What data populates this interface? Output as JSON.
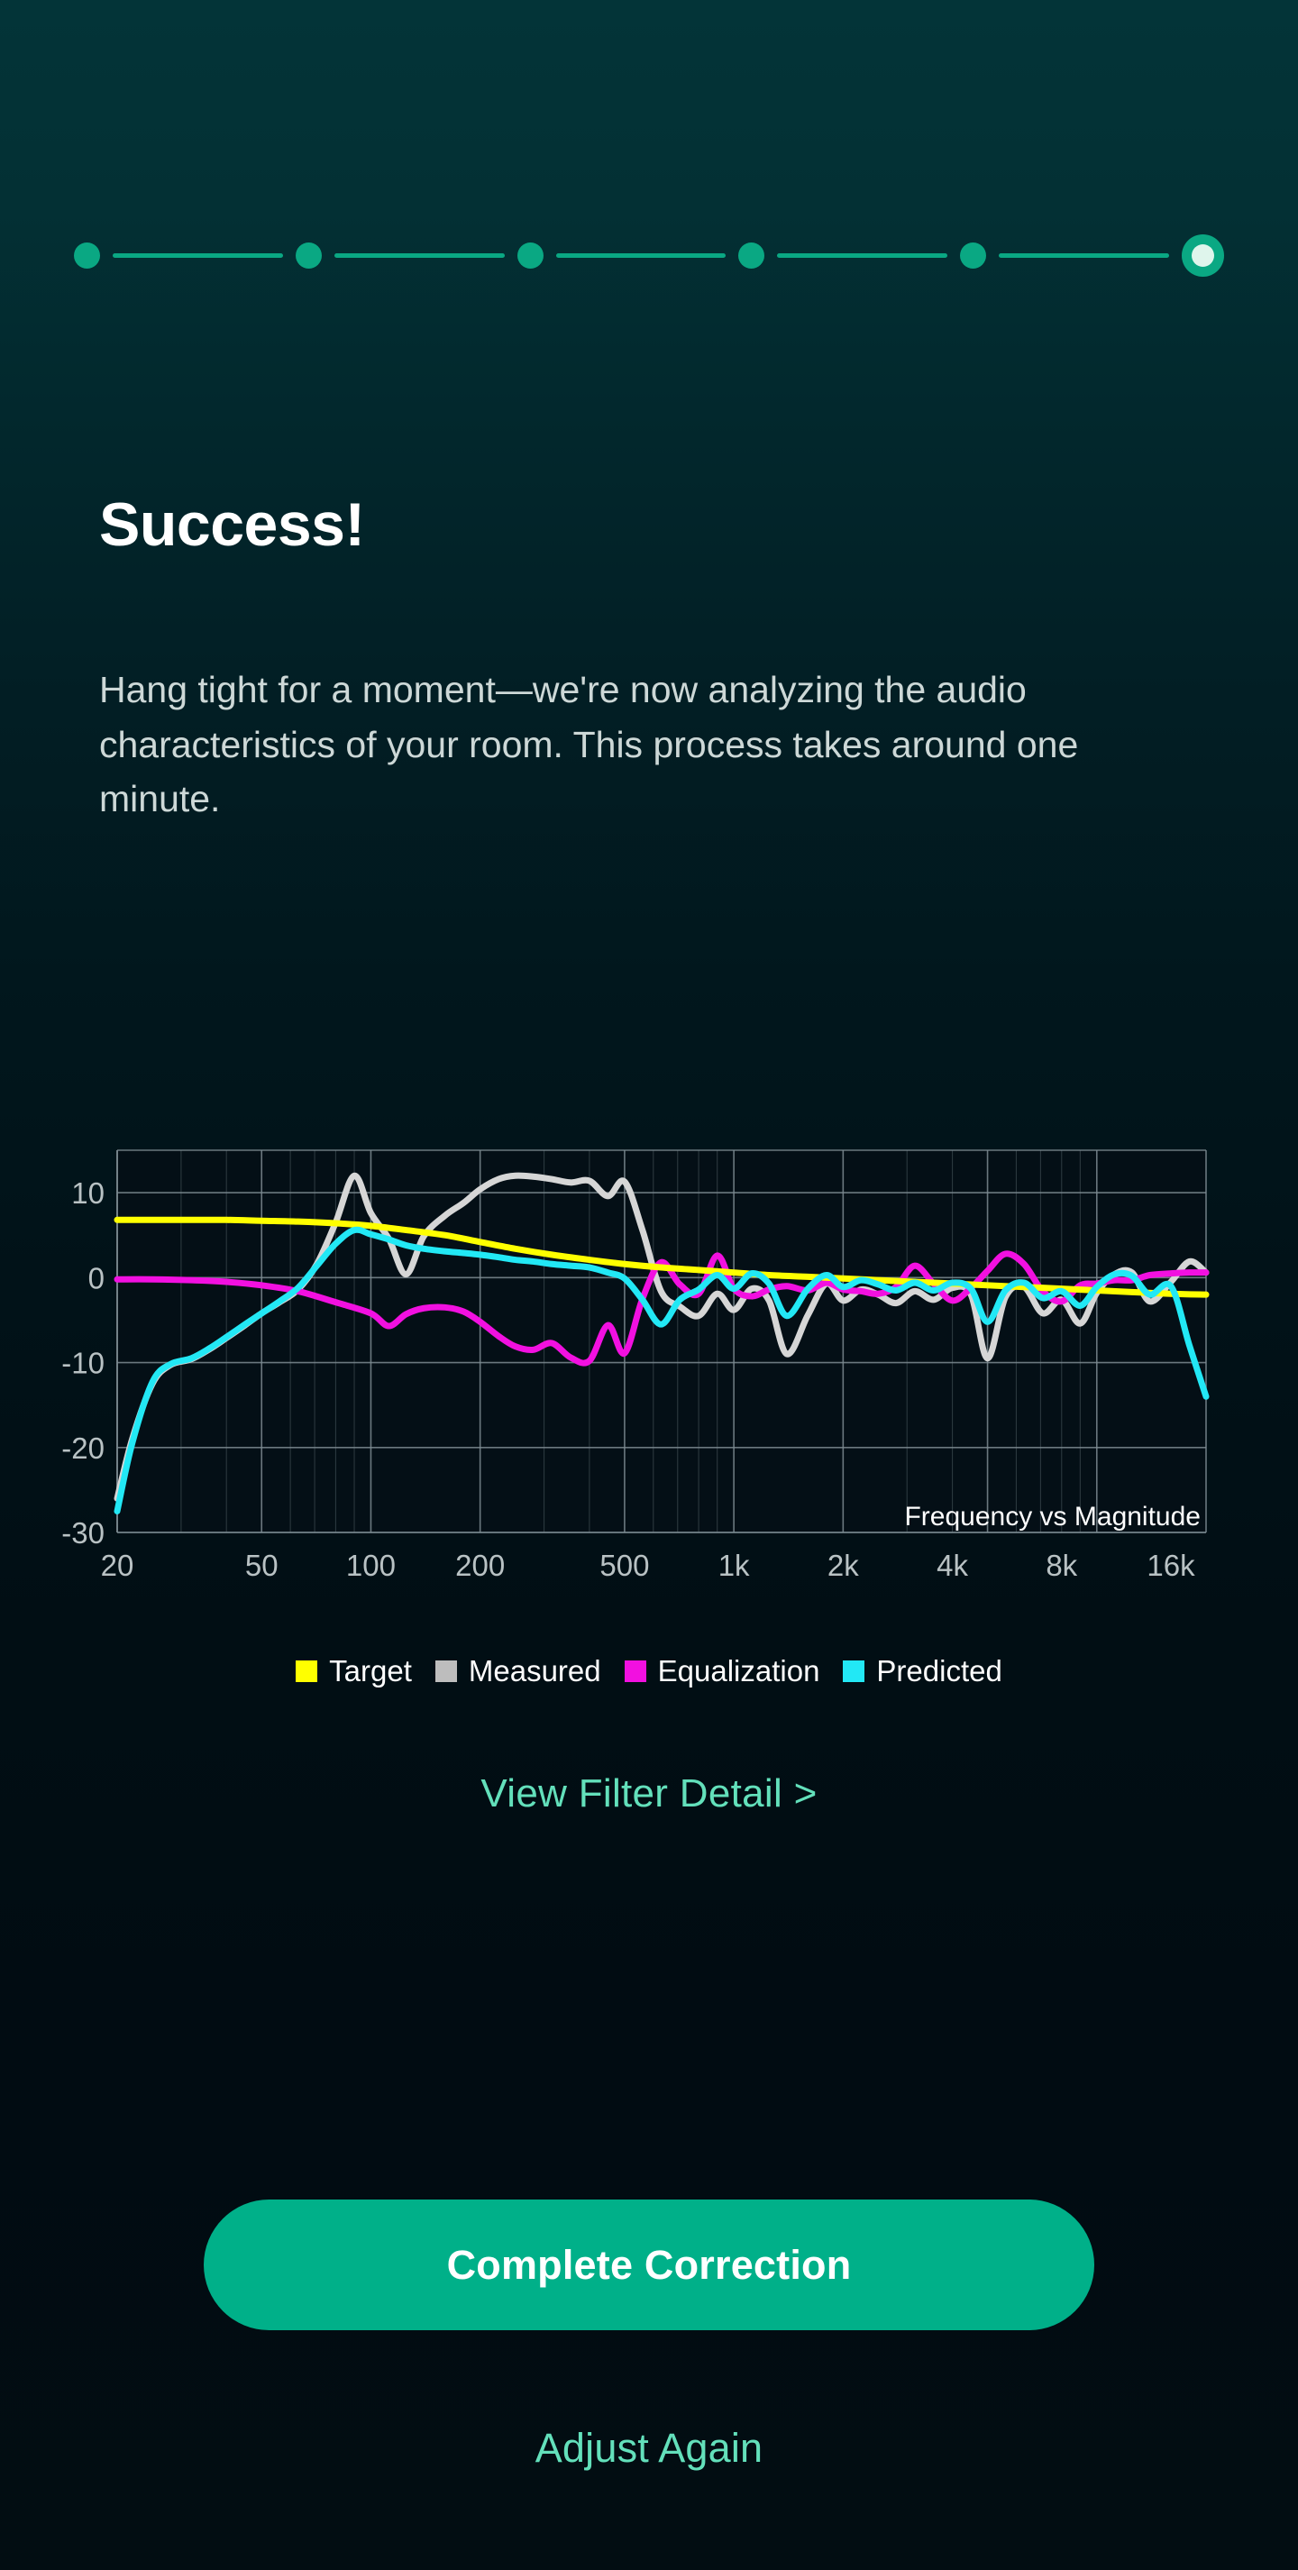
{
  "theme": {
    "accent": "#0aa883",
    "accent_button": "#00b089",
    "link": "#63e0bb",
    "bg_top": "#033438",
    "bg_bottom": "#020d12",
    "title_color": "#ffffff",
    "body_color": "#cdd8d7"
  },
  "stepper": {
    "total_steps": 6,
    "current_step": 6,
    "steps": [
      {
        "label": "step-1",
        "state": "done"
      },
      {
        "label": "step-2",
        "state": "done"
      },
      {
        "label": "step-3",
        "state": "done"
      },
      {
        "label": "step-4",
        "state": "done"
      },
      {
        "label": "step-5",
        "state": "done"
      },
      {
        "label": "step-6",
        "state": "active"
      }
    ]
  },
  "header": {
    "title": "Success!",
    "body": "Hang tight for a moment—we're now analyzing the audio characteristics of your room. This process takes around one minute."
  },
  "chart_data": {
    "type": "line",
    "title": "Frequency vs Magnitude",
    "xlabel": "",
    "ylabel": "",
    "xscale": "log",
    "grid": true,
    "legend_position": "bottom",
    "xlim": [
      20,
      20000
    ],
    "ylim": [
      -30,
      15
    ],
    "x_ticks": [
      20,
      50,
      100,
      200,
      500,
      1000,
      2000,
      4000,
      8000,
      16000
    ],
    "x_tick_labels": [
      "20",
      "50",
      "100",
      "200",
      "500",
      "1k",
      "2k",
      "4k",
      "8k",
      "16k"
    ],
    "y_ticks": [
      10,
      0,
      -10,
      -20,
      -30
    ],
    "y_tick_labels": [
      "10",
      "0",
      "-10",
      "-20",
      "-30"
    ],
    "series": [
      {
        "name": "Target",
        "color": "#ffff00",
        "x": [
          20,
          25,
          32,
          40,
          50,
          63,
          80,
          100,
          125,
          160,
          200,
          250,
          315,
          400,
          500,
          630,
          800,
          1000,
          1250,
          1600,
          2000,
          2500,
          3150,
          4000,
          5000,
          6300,
          8000,
          10000,
          12500,
          16000,
          20000
        ],
        "values": [
          6.8,
          6.8,
          6.8,
          6.8,
          6.7,
          6.6,
          6.4,
          6.1,
          5.6,
          5.0,
          4.2,
          3.4,
          2.7,
          2.1,
          1.6,
          1.2,
          0.9,
          0.6,
          0.3,
          0.1,
          -0.1,
          -0.3,
          -0.5,
          -0.7,
          -0.9,
          -1.1,
          -1.3,
          -1.5,
          -1.7,
          -1.9,
          -2.0
        ]
      },
      {
        "name": "Measured",
        "color": "#d6d6d6",
        "x": [
          20,
          22,
          25,
          28,
          32,
          36,
          40,
          45,
          50,
          56,
          63,
          71,
          80,
          90,
          100,
          112,
          125,
          140,
          160,
          180,
          200,
          225,
          250,
          280,
          315,
          355,
          400,
          450,
          500,
          560,
          630,
          710,
          800,
          900,
          1000,
          1120,
          1250,
          1400,
          1600,
          1800,
          2000,
          2240,
          2500,
          2800,
          3150,
          3550,
          4000,
          4500,
          5000,
          5600,
          6300,
          7100,
          8000,
          9000,
          10000,
          11200,
          12500,
          14000,
          16000,
          18000,
          20000
        ],
        "values": [
          -26.0,
          -19.0,
          -12.5,
          -10.3,
          -9.6,
          -8.4,
          -7.1,
          -5.6,
          -4.2,
          -2.9,
          -1.4,
          1.6,
          6.5,
          12.0,
          7.6,
          4.6,
          0.4,
          4.9,
          7.3,
          8.8,
          10.4,
          11.6,
          12.0,
          11.9,
          11.6,
          11.2,
          11.4,
          9.6,
          11.3,
          5.6,
          -1.6,
          -3.4,
          -4.5,
          -1.9,
          -3.8,
          -1.3,
          -2.7,
          -9.0,
          -4.4,
          -0.7,
          -2.7,
          -1.4,
          -2.0,
          -3.0,
          -1.6,
          -2.6,
          -1.2,
          -2.0,
          -9.5,
          -2.3,
          -1.1,
          -4.2,
          -2.6,
          -5.4,
          -1.8,
          0.4,
          0.6,
          -2.8,
          -0.5,
          1.9,
          0.6
        ]
      },
      {
        "name": "Equalization",
        "color": "#f210e0",
        "x": [
          20,
          25,
          32,
          40,
          50,
          63,
          80,
          100,
          112,
          125,
          140,
          160,
          180,
          200,
          225,
          250,
          280,
          315,
          355,
          400,
          450,
          500,
          560,
          630,
          710,
          800,
          900,
          1000,
          1120,
          1250,
          1400,
          1600,
          1800,
          2000,
          2240,
          2500,
          2800,
          3150,
          3550,
          4000,
          4500,
          5000,
          5600,
          6300,
          7100,
          8000,
          9000,
          10000,
          11200,
          12500,
          14000,
          16000,
          18000,
          20000
        ],
        "values": [
          -0.2,
          -0.2,
          -0.3,
          -0.5,
          -0.9,
          -1.6,
          -2.9,
          -4.2,
          -5.7,
          -4.3,
          -3.6,
          -3.5,
          -4.0,
          -5.2,
          -6.9,
          -8.1,
          -8.5,
          -7.7,
          -9.4,
          -9.8,
          -5.6,
          -8.9,
          -2.5,
          1.8,
          -0.8,
          -1.9,
          2.6,
          -1.3,
          -2.2,
          -1.4,
          -1.0,
          -1.5,
          -0.6,
          -1.4,
          -1.6,
          -1.9,
          -1.1,
          1.4,
          -0.7,
          -2.7,
          -1.2,
          0.8,
          2.8,
          1.6,
          -1.6,
          -2.8,
          -0.9,
          -0.7,
          -0.3,
          -0.3,
          0.3,
          0.5,
          0.6,
          0.6
        ]
      },
      {
        "name": "Predicted",
        "color": "#22e8f5",
        "x": [
          20,
          22,
          25,
          28,
          32,
          36,
          40,
          45,
          50,
          56,
          63,
          71,
          80,
          90,
          100,
          112,
          125,
          140,
          160,
          180,
          200,
          225,
          250,
          280,
          315,
          355,
          400,
          450,
          500,
          560,
          630,
          710,
          800,
          900,
          1000,
          1120,
          1250,
          1400,
          1600,
          1800,
          2000,
          2240,
          2500,
          2800,
          3150,
          3550,
          4000,
          4500,
          5000,
          5600,
          6300,
          7100,
          8000,
          9000,
          10000,
          11200,
          12500,
          14000,
          16000,
          18000,
          20000
        ],
        "values": [
          -27.5,
          -19.5,
          -12.3,
          -10.2,
          -9.5,
          -8.3,
          -7.0,
          -5.5,
          -4.2,
          -2.8,
          -1.2,
          1.4,
          4.0,
          5.6,
          5.1,
          4.5,
          3.8,
          3.4,
          3.1,
          2.9,
          2.7,
          2.4,
          2.1,
          1.9,
          1.6,
          1.4,
          1.2,
          0.6,
          -0.1,
          -2.6,
          -5.5,
          -2.6,
          -1.4,
          0.3,
          -1.3,
          0.5,
          -0.7,
          -4.5,
          -1.3,
          0.3,
          -1.1,
          -0.3,
          -0.8,
          -1.5,
          -0.6,
          -1.5,
          -0.6,
          -1.3,
          -5.2,
          -1.5,
          -0.6,
          -2.4,
          -1.6,
          -3.3,
          -1.1,
          0.4,
          0.2,
          -2.0,
          -1.0,
          -8.0,
          -14.0
        ]
      }
    ]
  },
  "chart_link": {
    "label": "View Filter Detail >"
  },
  "actions": {
    "primary_label": "Complete Correction",
    "secondary_label": "Adjust Again"
  }
}
